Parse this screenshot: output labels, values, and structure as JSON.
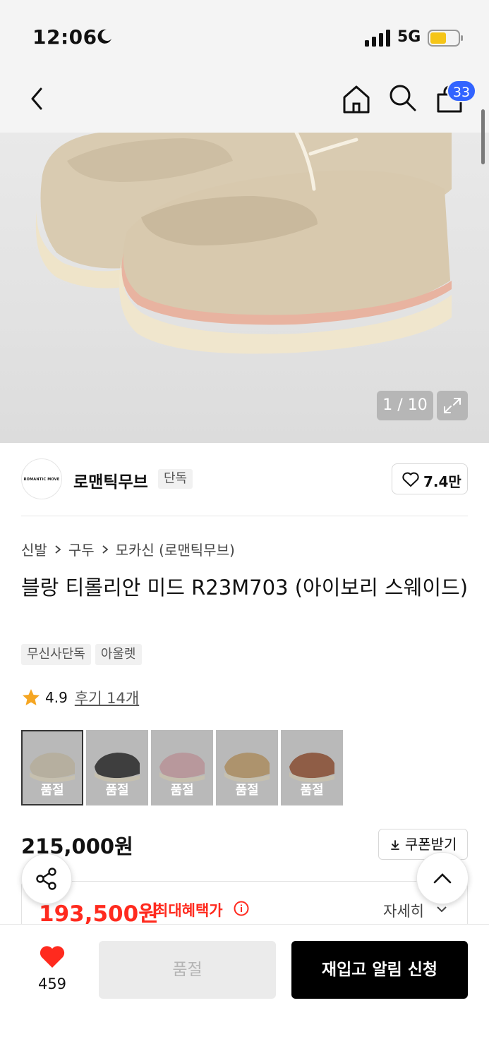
{
  "status_bar": {
    "time": "12:06",
    "network": "5G",
    "battery_color": "#f5c518"
  },
  "nav": {
    "cart_count": "33"
  },
  "gallery": {
    "counter": "1 / 10"
  },
  "brand": {
    "logo_text": "ROMANTIC MOVE",
    "name": "로맨틱무브",
    "chip": "단독",
    "likes": "7.4만"
  },
  "breadcrumb": [
    "신발",
    "구두",
    "모카신 (로맨틱무브)"
  ],
  "product": {
    "title": "블랑 티롤리안 미드 R23M703 (아이보리 스웨이드)",
    "tags": [
      "무신사단독",
      "아울렛"
    ],
    "rating": "4.9",
    "reviews": "후기 14개"
  },
  "color_options": [
    {
      "color": "#d8cdb4",
      "label": "품절"
    },
    {
      "color": "#1f1f1f",
      "label": "품절"
    },
    {
      "color": "#dba9b0",
      "label": "품절"
    },
    {
      "color": "#c9a167",
      "label": "품절"
    },
    {
      "color": "#9b4f2c",
      "label": "품절"
    }
  ],
  "price": {
    "original": "215,000원",
    "coupon_label": "쿠폰받기",
    "sale": "193,500원",
    "max_benefit_label": "최대혜택가",
    "detail_label": "자세히"
  },
  "bottom_bar": {
    "like_count": "459",
    "soldout_label": "품절",
    "restock_label": "재입고 알림 신청",
    "accent_color": "#ff2a1e"
  }
}
